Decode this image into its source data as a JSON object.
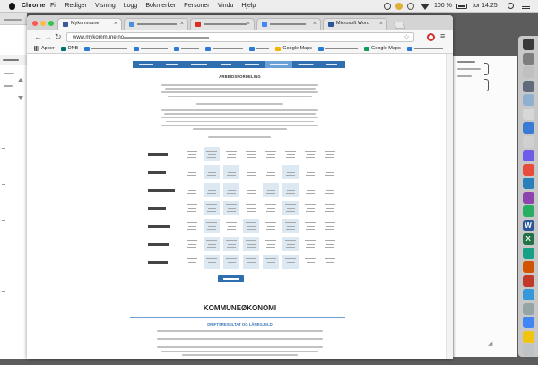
{
  "menubar": {
    "app_name": "Chrome",
    "items": [
      "Fil",
      "Rediger",
      "Visning",
      "Logg",
      "Bokmerker",
      "Personer",
      "Vindu",
      "Hjelp"
    ],
    "battery": "100 %",
    "clock": "tor 14.25"
  },
  "browser": {
    "tabs": [
      {
        "label": "Mykommune",
        "icon_color": "#3b5998",
        "active": true
      },
      {
        "icon_color": "#4a90d9"
      },
      {
        "icon_color": "#d93025"
      },
      {
        "icon_color": "#4285f4"
      },
      {
        "label": "Microsoft Word",
        "icon_color": "#2b579a"
      }
    ],
    "url": "www.mykommune.no",
    "bookmarks": [
      {
        "label": "Apper",
        "icon": "apps-grid-icon"
      },
      {
        "label": "DNB",
        "icon_color": "#007272"
      },
      {
        "icon_color": "#2b7bd6"
      },
      {
        "icon_color": "#2b7bd6"
      },
      {
        "icon_color": "#2b7bd6"
      },
      {
        "icon_color": "#2b7bd6"
      },
      {
        "icon_color": "#2b7bd6"
      },
      {
        "label": "Google Maps",
        "icon_color": "#f4b400"
      },
      {
        "icon_color": "#2b7bd6"
      },
      {
        "label": "Google Maps",
        "icon_color": "#0f9d58"
      },
      {
        "icon_color": "#2b7bd6"
      }
    ]
  },
  "page": {
    "nav_active_index": 5,
    "section_title": "ARBEIDSFORDELING",
    "grid_highlight": [
      [
        0,
        1,
        0,
        0,
        0,
        0,
        0,
        0
      ],
      [
        0,
        1,
        1,
        0,
        0,
        1,
        0,
        0
      ],
      [
        0,
        1,
        1,
        0,
        1,
        1,
        0,
        0
      ],
      [
        0,
        1,
        1,
        0,
        0,
        1,
        0,
        0
      ],
      [
        0,
        1,
        0,
        1,
        0,
        1,
        0,
        0
      ],
      [
        0,
        1,
        1,
        1,
        0,
        1,
        0,
        0
      ],
      [
        0,
        1,
        1,
        1,
        1,
        1,
        0,
        0
      ]
    ],
    "heading": "KOMMUNEØKONOMI",
    "subheading": "DRIFTSRESULTAT OG LÅNEGJELD"
  },
  "dock": {
    "icons": [
      {
        "icon": "app-icon",
        "color": "#3a3a3a"
      },
      {
        "icon": "app-icon",
        "color": "#7d7d7d"
      },
      {
        "icon": "app-icon",
        "color": "#c0c0c0"
      },
      {
        "icon": "app-icon",
        "color": "#5f6b7a"
      },
      {
        "icon": "app-icon",
        "color": "#8fb0d0"
      },
      {
        "icon": "app-icon",
        "color": "#d7d7d7"
      },
      {
        "icon": "app-icon",
        "color": "#3a7bd5"
      },
      {
        "icon": "app-icon",
        "color": "#d0d0d0"
      },
      {
        "icon": "app-icon",
        "color": "#6c5ce7"
      },
      {
        "icon": "app-icon",
        "color": "#e74c3c"
      },
      {
        "icon": "app-icon",
        "color": "#2980b9"
      },
      {
        "icon": "app-icon",
        "color": "#8e44ad"
      },
      {
        "icon": "app-icon",
        "color": "#27ae60"
      },
      {
        "icon": "word-icon",
        "color": "#2b579a",
        "glyph": "W"
      },
      {
        "icon": "excel-icon",
        "color": "#217346",
        "glyph": "X"
      },
      {
        "icon": "app-icon",
        "color": "#16a085"
      },
      {
        "icon": "app-icon",
        "color": "#d35400"
      },
      {
        "icon": "app-icon",
        "color": "#c0392b"
      },
      {
        "icon": "app-icon",
        "color": "#3498db"
      },
      {
        "icon": "app-icon",
        "color": "#95a5a6"
      },
      {
        "icon": "app-icon",
        "color": "#4285f4"
      },
      {
        "icon": "app-icon",
        "color": "#f1c40f"
      },
      {
        "icon": "trash-icon",
        "color": "#bdc3c7"
      }
    ]
  },
  "colors": {
    "accent": "#2f6fb0",
    "cell_highlight": "#dce9f3",
    "subheading": "#3d7ab8"
  }
}
